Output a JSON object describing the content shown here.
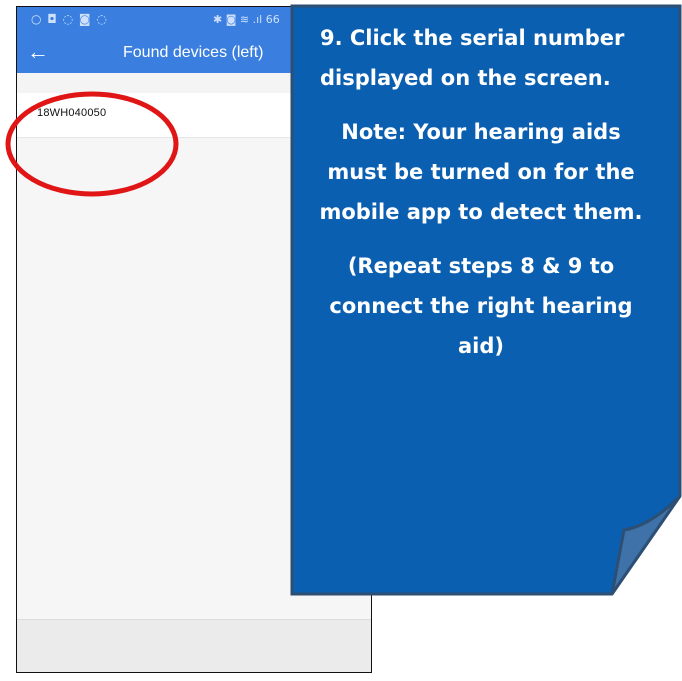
{
  "phone": {
    "status_bar": {
      "left_icons": "○ ◘ ◌ ◙ ◌",
      "right_icons": "✱ ◙ ≋ .ıl 66"
    },
    "app_bar": {
      "back_icon": "←",
      "title": "Found devices (left)"
    },
    "device_list": [
      {
        "serial": "18WH040050"
      }
    ],
    "colors": {
      "app_bar": "#3a7fe0",
      "highlight": "#e01515"
    }
  },
  "callout": {
    "step": "9. Click the serial number displayed on the screen.",
    "note": "Note: Your hearing aids must be turned on for the mobile app to detect them.",
    "repeat": "(Repeat steps 8 & 9 to connect the right hearing aid)",
    "colors": {
      "fill": "#0b5fb0",
      "border": "#2d4f73"
    }
  }
}
